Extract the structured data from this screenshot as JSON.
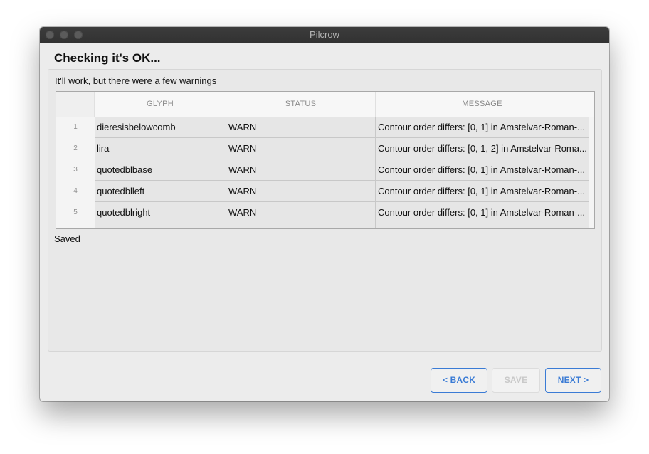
{
  "window": {
    "title": "Pilcrow"
  },
  "page": {
    "title": "Checking it's OK...",
    "subtitle": "It'll work, but there were a few warnings",
    "status": "Saved"
  },
  "table": {
    "columns": [
      "GLYPH",
      "STATUS",
      "MESSAGE"
    ],
    "rows": [
      {
        "num": "1",
        "glyph": "dieresisbelowcomb",
        "status": "WARN",
        "message": "Contour order differs: [0, 1] in Amstelvar-Roman-..."
      },
      {
        "num": "2",
        "glyph": "lira",
        "status": "WARN",
        "message": "Contour order differs: [0, 1, 2] in Amstelvar-Roma..."
      },
      {
        "num": "3",
        "glyph": "quotedblbase",
        "status": "WARN",
        "message": "Contour order differs: [0, 1] in Amstelvar-Roman-..."
      },
      {
        "num": "4",
        "glyph": "quotedblleft",
        "status": "WARN",
        "message": "Contour order differs: [0, 1] in Amstelvar-Roman-..."
      },
      {
        "num": "5",
        "glyph": "quotedblright",
        "status": "WARN",
        "message": "Contour order differs: [0, 1] in Amstelvar-Roman-..."
      }
    ]
  },
  "buttons": {
    "back": "< BACK",
    "save": "SAVE",
    "next": "NEXT >"
  },
  "colors": {
    "accent": "#3a7bd5",
    "titlebar": "#3a3a3a",
    "window_bg": "#ececec"
  }
}
